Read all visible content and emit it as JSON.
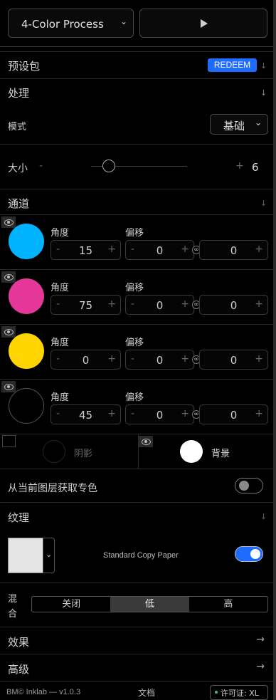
{
  "colors": {
    "accent": "#1f6bff",
    "cyan": "#00b3ff",
    "magenta": "#e5369a",
    "yellow": "#ffd400",
    "black": "#000000"
  },
  "header": {
    "preset_select": "4-Color Process",
    "play_icon": "play-icon"
  },
  "presets": {
    "title": "预设包",
    "redeem": "REDEEM"
  },
  "process": {
    "title": "处理",
    "mode_label": "模式",
    "mode_value": "基础",
    "size_label": "大小",
    "size_value": "6",
    "size_minus": "-",
    "size_plus": "+"
  },
  "channels": {
    "title": "通道",
    "angle_label": "角度",
    "offset_label": "偏移",
    "rows": [
      {
        "angle": "15",
        "offset_x": "0",
        "offset_y": "0"
      },
      {
        "angle": "75",
        "offset_x": "0",
        "offset_y": "0"
      },
      {
        "angle": "0",
        "offset_x": "0",
        "offset_y": "0"
      },
      {
        "angle": "45",
        "offset_x": "0",
        "offset_y": "0"
      }
    ],
    "minus": "-",
    "plus": "+",
    "link": "∞"
  },
  "shadow_bg": {
    "shadow": "阴影",
    "background": "背景"
  },
  "spot": {
    "label": "从当前图层获取专色",
    "enabled": false
  },
  "texture": {
    "title": "纹理",
    "paper_name": "Standard Copy Paper",
    "enabled": true
  },
  "blend": {
    "label_top": "混",
    "label_bottom": "合",
    "options": [
      "关闭",
      "低",
      "高"
    ],
    "selected": "低"
  },
  "effects": {
    "title": "效果"
  },
  "advanced": {
    "title": "高级"
  },
  "footer": {
    "version": "BM© Inklab — v1.0.3",
    "docs": "文档",
    "license": "许可证: XL"
  }
}
